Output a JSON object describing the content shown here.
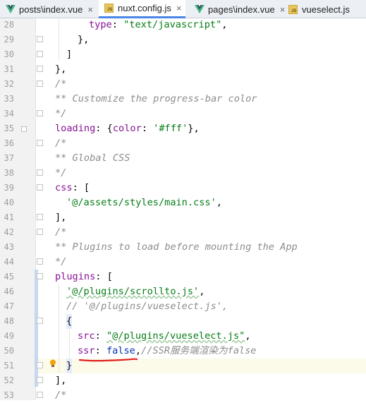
{
  "tabs": [
    {
      "label": "posts\\index.vue",
      "icon": "vue-icon",
      "active": false
    },
    {
      "label": "nuxt.config.js",
      "icon": "js-icon",
      "active": true
    },
    {
      "label": "pages\\index.vue",
      "icon": "vue-icon",
      "active": false
    },
    {
      "label": "vueselect.js",
      "icon": "js-icon",
      "active": false
    }
  ],
  "close_glyph": "×",
  "js_badge": "JS",
  "line_numbers": [
    "28",
    "29",
    "30",
    "31",
    "32",
    "33",
    "34",
    "35",
    "36",
    "37",
    "38",
    "39",
    "40",
    "41",
    "42",
    "43",
    "44",
    "45",
    "46",
    "47",
    "48",
    "49",
    "50",
    "51",
    "52",
    "53"
  ],
  "code": {
    "l28": {
      "key": "type",
      "colon": ": ",
      "str": "\"text/javascript\"",
      "end": ","
    },
    "l29": "},",
    "l30": "]",
    "l31": "},",
    "l32": "/*",
    "l33": "** Customize the progress-bar color",
    "l34": "*/",
    "l35": {
      "key": "loading",
      "pre": ": {",
      "key2": "color",
      "colon": ": ",
      "str": "'#fff'",
      "end": "},"
    },
    "l36": "/*",
    "l37": "** Global CSS",
    "l38": "*/",
    "l39": {
      "key": "css",
      "end": ": ["
    },
    "l40": {
      "str": "'@/assets/styles/main.css'",
      "end": ","
    },
    "l41": "],",
    "l42": "/*",
    "l43": "** Plugins to load before mounting the App",
    "l44": "*/",
    "l45": {
      "key": "plugins",
      "end": ": ["
    },
    "l46": {
      "str": "'@/plugins/scrollto.js'",
      "end": ","
    },
    "l47": "// '@/plugins/vueselect.js',",
    "l48": "{",
    "l49": {
      "key": "src",
      "colon": ": ",
      "str": "\"@/plugins/vueselect.js\"",
      "end": ","
    },
    "l50": {
      "key": "ssr",
      "colon": ": ",
      "kw": "false",
      "end": ",",
      "comment": "//SSR服务端渲染为false"
    },
    "l51": "}",
    "l52": "],",
    "l53": "/*"
  },
  "colors": {
    "accent": "#4a86e8",
    "annotation": "#e02020",
    "bulb": "#f0a30a"
  }
}
